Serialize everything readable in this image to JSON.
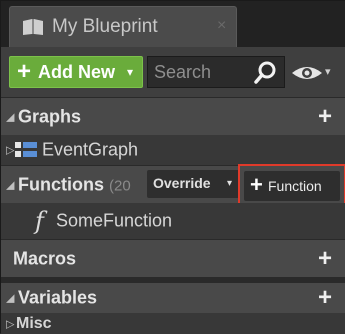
{
  "tab": {
    "title": "My Blueprint",
    "close": "×",
    "icon": "blueprint-book-icon"
  },
  "toolbar": {
    "add_new_label": "Add New",
    "add_plus": "+",
    "search_placeholder": "Search",
    "search_icon": "magnifier-icon",
    "view_icon": "eye-icon",
    "caret": "▾"
  },
  "sections": {
    "graphs": {
      "label": "Graphs",
      "expanded": true,
      "triangle": "◢",
      "add": "+"
    },
    "event_graph": {
      "label": "EventGraph",
      "triangle": "▷",
      "icon": "event-graph-icon"
    },
    "functions": {
      "label": "Functions",
      "count": "(20",
      "triangle": "◢",
      "override_label": "Override",
      "add_plus": "+",
      "add_label": "Function",
      "highlight_color": "#e03a2a"
    },
    "some_function": {
      "label": "SomeFunction",
      "glyph": "f"
    },
    "macros": {
      "label": "Macros",
      "add": "+"
    },
    "variables": {
      "label": "Variables",
      "triangle": "◢",
      "add": "+"
    },
    "misc": {
      "label": "Misc",
      "triangle": "▷"
    }
  },
  "colors": {
    "add_new_green": "#6aac3b",
    "category_bg": "#494949",
    "panel_bg": "#383838"
  }
}
